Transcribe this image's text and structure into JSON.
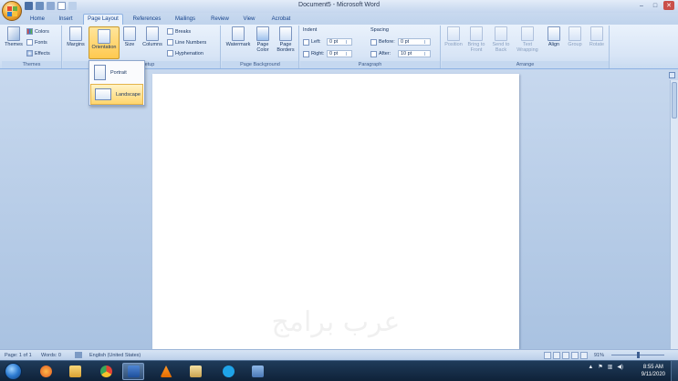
{
  "window": {
    "title": "Document5 - Microsoft Word",
    "controls": [
      "–",
      "□",
      "✕"
    ]
  },
  "tabs": [
    "Home",
    "Insert",
    "Page Layout",
    "References",
    "Mailings",
    "Review",
    "View",
    "Acrobat"
  ],
  "active_tab": "Page Layout",
  "ribbon": {
    "themes": {
      "themes_label": "Themes",
      "colors": "Colors",
      "fonts": "Fonts",
      "effects": "Effects",
      "group_label": "Themes"
    },
    "page_setup": {
      "margins": "Margins",
      "orientation": "Orientation",
      "size": "Size",
      "columns": "Columns",
      "breaks": "Breaks",
      "line_numbers": "Line Numbers",
      "hyphenation": "Hyphenation",
      "group_label": "Page Setup"
    },
    "page_background": {
      "watermark": "Watermark",
      "page_color_1": "Page",
      "page_color_2": "Color",
      "page_borders_1": "Page",
      "page_borders_2": "Borders",
      "group_label": "Page Background"
    },
    "paragraph": {
      "indent_label": "Indent",
      "left_label": "Left:",
      "left_value": "0 pt",
      "right_label": "Right:",
      "right_value": "0 pt",
      "spacing_label": "Spacing",
      "before_label": "Before:",
      "before_value": "0 pt",
      "after_label": "After:",
      "after_value": "10 pt",
      "group_label": "Paragraph"
    },
    "arrange": {
      "position": "Position",
      "bring_to_front_1": "Bring to",
      "bring_to_front_2": "Front",
      "send_to_back_1": "Send to",
      "send_to_back_2": "Back",
      "text_wrapping_1": "Text",
      "text_wrapping_2": "Wrapping",
      "align": "Align",
      "group": "Group",
      "rotate": "Rotate",
      "group_label": "Arrange"
    }
  },
  "orientation_menu": {
    "items": [
      {
        "label": "Portrait",
        "selected": false
      },
      {
        "label": "Landscape",
        "selected": true
      }
    ]
  },
  "document": {
    "watermark_text": "عرب برامج"
  },
  "statusbar": {
    "page": "Page: 1 of 1",
    "words": "Words: 0",
    "language": "English (United States)",
    "zoom": "91%"
  },
  "taskbar": {
    "time": "8:55 AM",
    "date": "9/11/2020"
  },
  "colors": {
    "ribbon_accent": "#ffc94f",
    "doc_background": "#a9c2e1",
    "taskbar": "#1f3b5a"
  }
}
